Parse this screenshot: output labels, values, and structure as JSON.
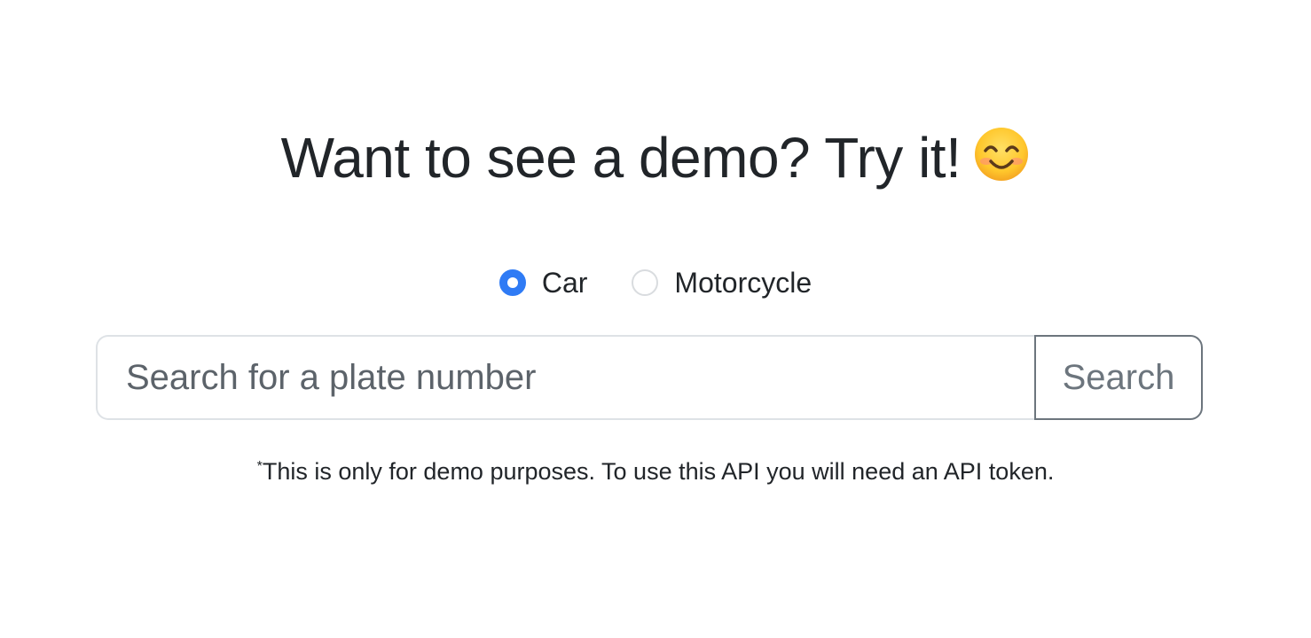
{
  "heading": {
    "text": "Want to see a demo? Try it!",
    "emoji": "smiling-face-icon"
  },
  "vehicle_type": {
    "options": [
      {
        "label": "Car",
        "checked": true
      },
      {
        "label": "Motorcycle",
        "checked": false
      }
    ]
  },
  "search": {
    "value": "",
    "placeholder": "Search for a plate number",
    "button_label": "Search"
  },
  "note": {
    "marker": "*",
    "text": "This is only for demo purposes. To use this API you will need an API token."
  },
  "colors": {
    "accent": "#2f7bf5",
    "button_border": "#6c757d",
    "text": "#212529"
  }
}
